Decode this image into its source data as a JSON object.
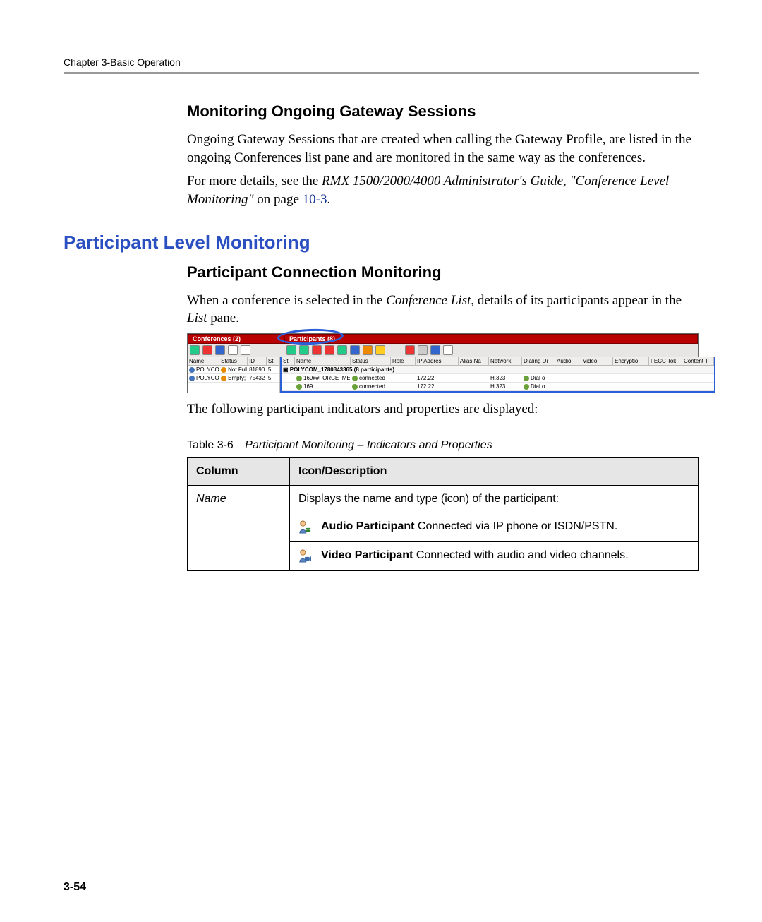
{
  "running_head": "Chapter 3-Basic Operation",
  "section1": {
    "heading": "Monitoring Ongoing Gateway Sessions",
    "para1": "Ongoing Gateway Sessions that are created when calling the Gateway Profile, are listed in the ongoing Conferences list pane and are monitored in the same way as the conferences.",
    "para2_pre": "For more details, see the ",
    "para2_em1": "RMX 1500/2000/4000 Administrator's Guide",
    "para2_mid": ", ",
    "para2_em2": "\"Conference Level Monitoring\"",
    "para2_post": " on page ",
    "para2_link": "10-3",
    "para2_end": "."
  },
  "section2": {
    "title": "Participant Level Monitoring",
    "subheading": "Participant Connection Monitoring",
    "para1_pre": "When a conference is selected in the ",
    "para1_em1": "Conference List",
    "para1_mid": ", details of its participants appear in the ",
    "para1_em2": "List",
    "para1_post": " pane.",
    "para_after": "The following participant indicators and properties are displayed:"
  },
  "ui": {
    "tab_conferences": "Conferences (2)",
    "tab_participants": "Participants (8)",
    "conf_cols": {
      "name": "Name",
      "status": "Status",
      "id": "ID",
      "st": "St"
    },
    "part_cols": {
      "st": "St",
      "name": "Name",
      "status": "Status",
      "role": "Role",
      "ip": "IP Addres",
      "alias": "Alias Na",
      "network": "Network",
      "dialing": "Dialing Di",
      "audio": "Audio",
      "video": "Video",
      "encrypt": "Encryptio",
      "fecc": "FECC Tok",
      "content": "Content T"
    },
    "conf_rows": [
      {
        "name": "POLYCOM",
        "status": "Not Full; F",
        "id": "81890",
        "st": "5"
      },
      {
        "name": "POLYCOM",
        "status": "Empty;",
        "id": "75432",
        "st": "5"
      }
    ],
    "group_row": "POLYCOM_1780343365 (8 participants)",
    "part_rows": [
      {
        "name": "169##FORCE_ME",
        "status": "connected",
        "ip": "172.22.",
        "network": "H.323",
        "dialing": "Dial o"
      },
      {
        "name": "169",
        "status": "connected",
        "ip": "172.22.",
        "network": "H.323",
        "dialing": "Dial o"
      }
    ]
  },
  "table": {
    "caption_label": "Table 3-6",
    "caption_title": "Participant Monitoring – Indicators and Properties",
    "head_col": "Column",
    "head_desc": "Icon/Description",
    "row_name_label": "Name",
    "row_name_desc": "Displays the name and type (icon) of the participant:",
    "audio_label": "Audio Participant",
    "audio_desc": "  Connected via IP phone or ISDN/PSTN.",
    "video_label": "Video Participant",
    "video_desc": "  Connected with audio and video channels."
  },
  "page_number": "3-54"
}
